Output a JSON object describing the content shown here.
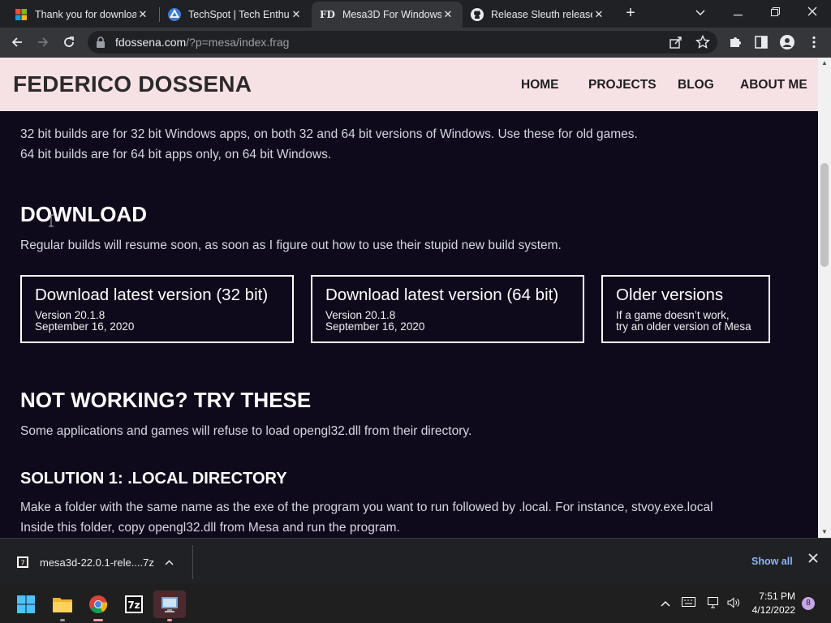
{
  "browser": {
    "tabs": [
      {
        "title": "Thank you for downloading",
        "favicon": "windows-logo-icon"
      },
      {
        "title": "TechSpot | Tech Enthusiasts",
        "favicon": "techspot-icon"
      },
      {
        "title": "Mesa3D For Windows",
        "favicon": "fd-logo-icon",
        "favicon_text": "FD",
        "active": true
      },
      {
        "title": "Release Sleuth release",
        "favicon": "github-icon"
      }
    ],
    "address_bar": {
      "host": "fdossena.com",
      "path": "/?p=mesa/index.frag"
    }
  },
  "site": {
    "title": "FEDERICO DOSSENA",
    "nav": [
      "HOME",
      "PROJECTS",
      "BLOG",
      "ABOUT ME"
    ]
  },
  "content": {
    "intro_lines": [
      "32 bit builds are for 32 bit Windows apps, on both 32 and 64 bit versions of Windows. Use these for old games.",
      "64 bit builds are for 64 bit apps only, on 64 bit Windows."
    ],
    "download_heading": "DOWNLOAD",
    "download_note": "Regular builds will resume soon, as soon as I figure out how to use their stupid new build system.",
    "download_buttons": [
      {
        "title": "Download latest version (32 bit)",
        "line1": "Version 20.1.8",
        "line2": "September 16, 2020"
      },
      {
        "title": "Download latest version (64 bit)",
        "line1": "Version 20.1.8",
        "line2": "September 16, 2020"
      },
      {
        "title": "Older versions",
        "line1": "If a game doesn’t work,",
        "line2": "try an older version of Mesa"
      }
    ],
    "troubleshoot_heading": "NOT WORKING? TRY THESE",
    "troubleshoot_note": "Some applications and games will refuse to load opengl32.dll from their directory.",
    "solution1_heading": "SOLUTION 1: .LOCAL DIRECTORY",
    "solution1_lines": [
      "Make a folder with the same name as the exe of the program you want to run followed by .local. For instance, stvoy.exe.local",
      "Inside this folder, copy opengl32.dll from Mesa and run the program."
    ]
  },
  "downloads_bar": {
    "file_name": "mesa3d-22.0.1-rele....7z",
    "show_all": "Show all"
  },
  "taskbar": {
    "apps": [
      "start-icon",
      "file-explorer-icon",
      "chrome-icon",
      "7zip-icon",
      "control-panel-icon"
    ],
    "app_7zip_label": "7z",
    "time": "7:51 PM",
    "date": "4/12/2022",
    "notification_count": "8"
  },
  "colors": {
    "page_bg": "#0f0a1b",
    "header_bg": "#f6e2e5",
    "link_blue": "#8ab4f8"
  }
}
